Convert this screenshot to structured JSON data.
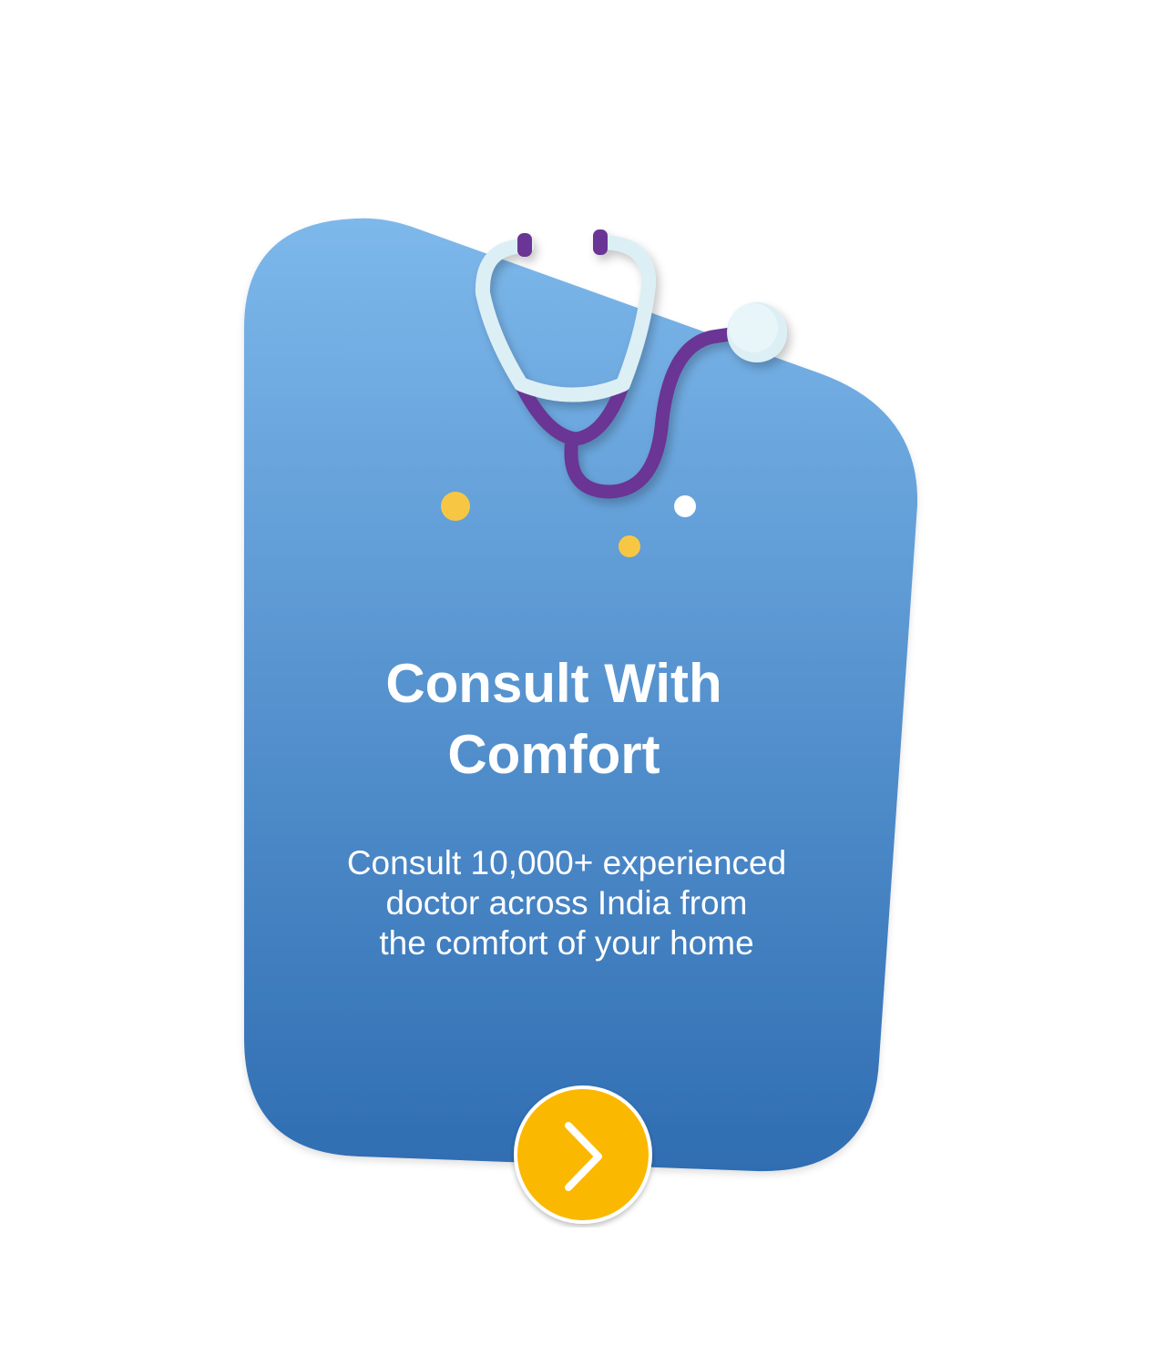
{
  "card": {
    "title_line1": "Consult With",
    "title_line2": "Comfort",
    "description_line1": "Consult 10,000+ experienced",
    "description_line2": "doctor across India from",
    "description_line3": "the comfort of your home"
  },
  "illustration": {
    "icon": "stethoscope-icon",
    "decorative_dots": [
      "yellow-dot",
      "white-dot",
      "yellow-dot"
    ]
  },
  "next_button": {
    "icon": "chevron-right-icon"
  },
  "colors": {
    "card_gradient_top": "#7DB8EB",
    "card_gradient_bottom": "#2F6DB2",
    "button_fill": "#FBB800",
    "button_ring": "#FFFFFF",
    "stethoscope_tube": "#6A3594",
    "stethoscope_metal": "#DCEFF5",
    "dot_yellow": "#F7C744",
    "dot_white": "#FFFFFF",
    "text": "#FFFFFF"
  }
}
